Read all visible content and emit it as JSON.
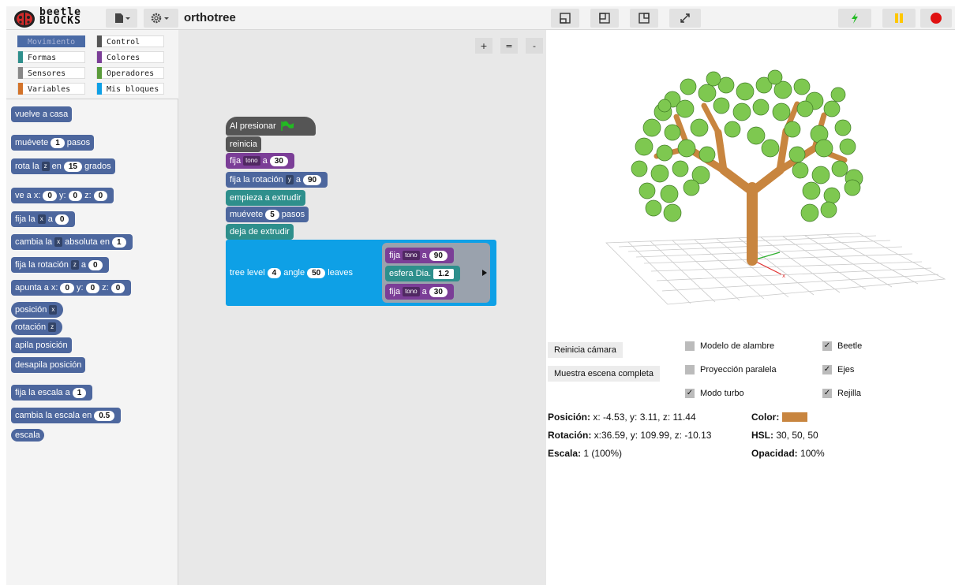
{
  "app": {
    "logo_line1": "beetle",
    "logo_line2": "BLOCKS",
    "project_name": "orthotree"
  },
  "categories": [
    {
      "label": "Movimiento",
      "color": "#4a6ba6"
    },
    {
      "label": "Control",
      "color": "#555555"
    },
    {
      "label": "Formas",
      "color": "#2e8f8c"
    },
    {
      "label": "Colores",
      "color": "#7b3e97"
    },
    {
      "label": "Sensores",
      "color": "#888888"
    },
    {
      "label": "Operadores",
      "color": "#5a9b3a"
    },
    {
      "label": "Variables",
      "color": "#d3732a"
    },
    {
      "label": "Mis bloques",
      "color": "#0ea0e6"
    }
  ],
  "palette": {
    "go_home": "vuelve a casa",
    "move_pre": "muévete",
    "move_val": "1",
    "move_post": "pasos",
    "rotate_pre": "rota la",
    "rotate_axis": "z",
    "rotate_mid": "en",
    "rotate_val": "15",
    "rotate_post": "grados",
    "goto_pre": "ve a x:",
    "goto_x": "0",
    "goto_y_lbl": "y:",
    "goto_y": "0",
    "goto_z_lbl": "z:",
    "goto_z": "0",
    "set_pre": "fija la",
    "set_axis": "x",
    "set_mid": "a",
    "set_val": "0",
    "change_pre": "cambia la",
    "change_axis": "x",
    "change_mid": "absoluta en",
    "change_val": "1",
    "setrot_pre": "fija la rotación",
    "setrot_axis": "z",
    "setrot_mid": "a",
    "setrot_val": "0",
    "point_pre": "apunta a x:",
    "point_x": "0",
    "point_y_lbl": "y:",
    "point_y": "0",
    "point_z_lbl": "z:",
    "point_z": "0",
    "position_lbl": "posición",
    "position_axis": "x",
    "rotation_lbl": "rotación",
    "rotation_axis": "z",
    "push_pos": "apila posición",
    "pop_pos": "desapila posición",
    "setscale_pre": "fija la escala a",
    "setscale_val": "1",
    "changescale_pre": "cambia la escala en",
    "changescale_val": "0.5",
    "scale_lbl": "escala"
  },
  "zoom": {
    "plus": "+",
    "equals": "=",
    "minus": "-"
  },
  "script": {
    "hat": "Al presionar",
    "reset": "reinicia",
    "hue_pre": "fija",
    "hue_dd": "tono",
    "hue_mid": "a",
    "hue_val": "30",
    "rot_pre": "fija la rotación",
    "rot_dd": "y",
    "rot_mid": "a",
    "rot_val": "90",
    "start_ext": "empieza a extrudir",
    "move_pre": "muévete",
    "move_val": "5",
    "move_post": "pasos",
    "stop_ext": "deja de extrudir",
    "tree_pre": "tree level",
    "tree_level": "4",
    "tree_mid": "angle",
    "tree_angle": "50",
    "tree_post": "leaves",
    "leaf1_pre": "fija",
    "leaf1_dd": "tono",
    "leaf1_mid": "a",
    "leaf1_val": "90",
    "leaf2_pre": "esfera Dia.",
    "leaf2_val": "1.2",
    "leaf3_pre": "fija",
    "leaf3_dd": "tono",
    "leaf3_mid": "a",
    "leaf3_val": "30"
  },
  "stage_controls": {
    "reset_camera": "Reinicia cámara",
    "show_scene": "Muestra escena completa",
    "wireframe": "Modelo de alambre",
    "wireframe_checked": false,
    "parallel": "Proyección paralela",
    "parallel_checked": false,
    "turbo": "Modo turbo",
    "turbo_checked": true,
    "beetle": "Beetle",
    "beetle_checked": true,
    "axes": "Ejes",
    "axes_checked": true,
    "grid": "Rejilla",
    "grid_checked": true,
    "check_mark": "✓"
  },
  "status": {
    "position_label": "Posición:",
    "position_value": " x: -4.53, y: 3.11, z: 11.44",
    "rotation_label": "Rotación:",
    "rotation_value": " x:36.59, y: 109.99, z: -10.13",
    "scale_label": "Escala:",
    "scale_value": " 1 (100%)",
    "color_label": "Color:",
    "color_swatch": "#c8853f",
    "hsl_label": "HSL:",
    "hsl_value": " 30, 50, 50",
    "opacity_label": "Opacidad:",
    "opacity_value": " 100%"
  },
  "colors": {
    "turbo": "#22bb22",
    "pause": "#ffc700",
    "stop": "#e01010",
    "leaf": "#7ec850",
    "trunk": "#c8853f"
  }
}
